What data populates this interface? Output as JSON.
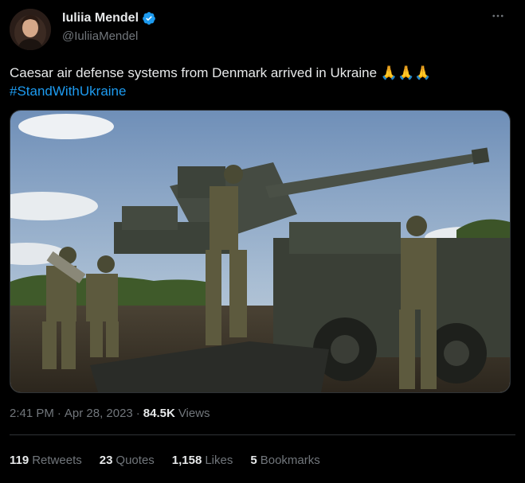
{
  "author": {
    "display_name": "Iuliia Mendel",
    "handle": "@IuliiaMendel",
    "verified": true
  },
  "icons": {
    "verified": "verified-badge-icon",
    "more": "more-options-icon"
  },
  "tweet": {
    "text": "Caesar air defense systems from Denmark arrived in Ukraine",
    "emoji": "🙏🙏🙏",
    "hashtag": "#StandWithUkraine"
  },
  "meta": {
    "time": "2:41 PM",
    "separator": "·",
    "date": "Apr 28, 2023",
    "separator2": "·",
    "views_count": "84.5K",
    "views_label": "Views"
  },
  "stats": {
    "retweets_count": "119",
    "retweets_label": "Retweets",
    "quotes_count": "23",
    "quotes_label": "Quotes",
    "likes_count": "1,158",
    "likes_label": "Likes",
    "bookmarks_count": "5",
    "bookmarks_label": "Bookmarks"
  },
  "colors": {
    "background": "#000000",
    "text_primary": "#e7e9ea",
    "text_secondary": "#71767b",
    "accent": "#1d9bf0",
    "divider": "#2f3336"
  }
}
